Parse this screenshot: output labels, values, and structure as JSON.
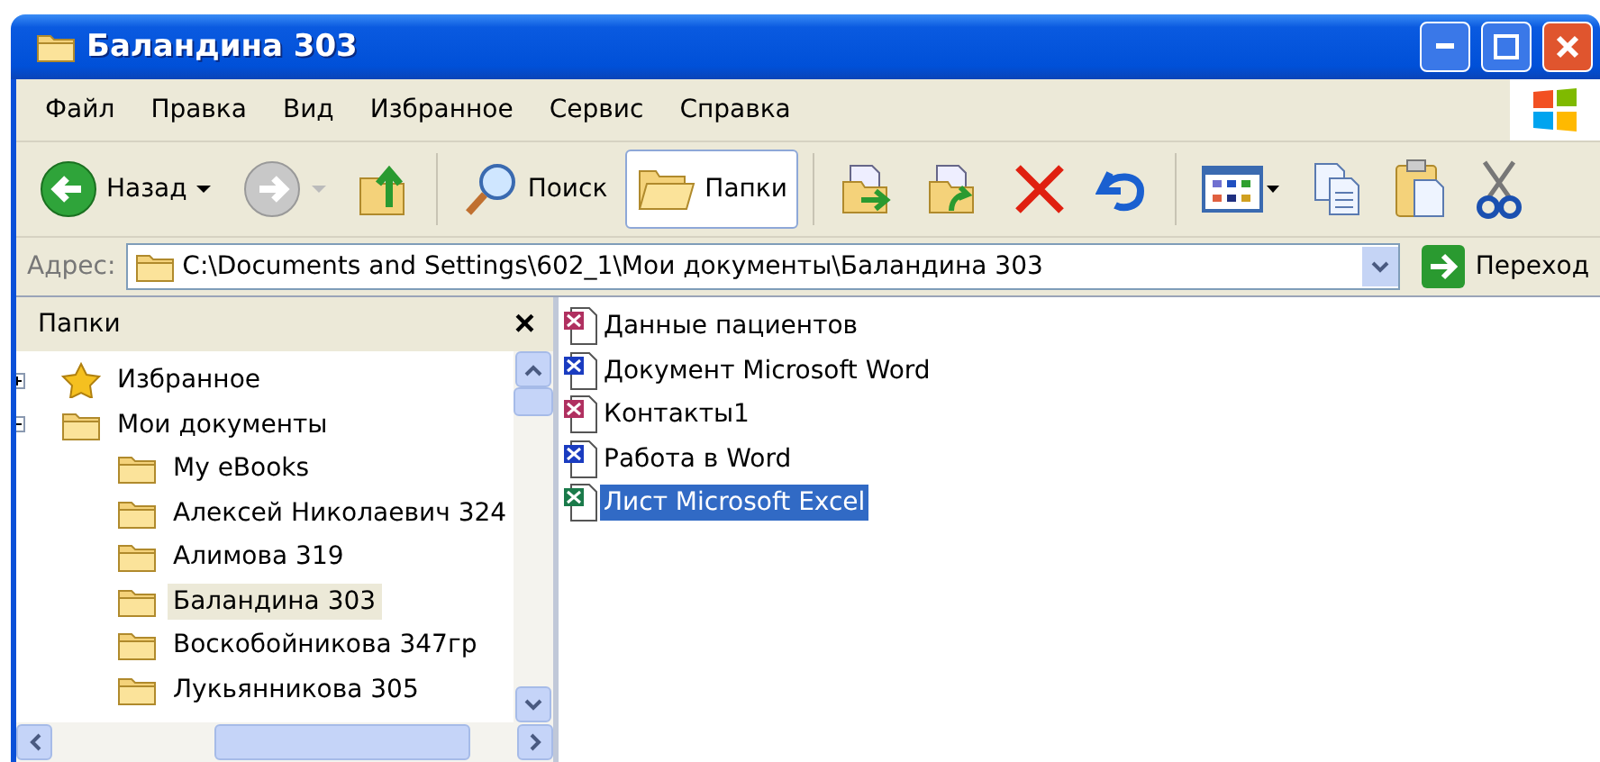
{
  "window": {
    "title": "Баландина 303"
  },
  "menu": [
    "Файл",
    "Правка",
    "Вид",
    "Избранное",
    "Сервис",
    "Справка"
  ],
  "toolbar": {
    "back": "Назад",
    "search": "Поиск",
    "folders": {
      "label": "Папки",
      "selected": true
    }
  },
  "address": {
    "label": "Адрес:",
    "value": "C:\\Documents and Settings\\602_1\\Мои документы\\Баландина 303",
    "go": "Переход"
  },
  "folders_pane": {
    "title": "Папки",
    "close": "×",
    "tree": [
      {
        "label": "Избранное",
        "kind": "star",
        "expanded": false,
        "selected": false
      },
      {
        "label": "Мои документы",
        "kind": "folder",
        "expanded": true,
        "selected": false,
        "children": [
          {
            "label": "My eBooks",
            "kind": "folder",
            "selected": false
          },
          {
            "label": "Алексей Николаевич 324",
            "kind": "folder",
            "selected": false
          },
          {
            "label": "Алимова 319",
            "kind": "folder",
            "selected": false
          },
          {
            "label": "Баландина 303",
            "kind": "folder",
            "selected": true
          },
          {
            "label": "Воскобойникова 347гр",
            "kind": "folder",
            "selected": false
          },
          {
            "label": "Лукьянникова 305",
            "kind": "folder",
            "selected": false
          }
        ]
      }
    ]
  },
  "files": [
    {
      "name": "Данные пациентов",
      "kind": "access",
      "selected": false
    },
    {
      "name": "Документ Microsoft Word",
      "kind": "word",
      "selected": false
    },
    {
      "name": "Контакты1",
      "kind": "access",
      "selected": false
    },
    {
      "name": "Работа в Word",
      "kind": "word",
      "selected": false
    },
    {
      "name": "Лист Microsoft Excel",
      "kind": "excel",
      "selected": true
    }
  ]
}
